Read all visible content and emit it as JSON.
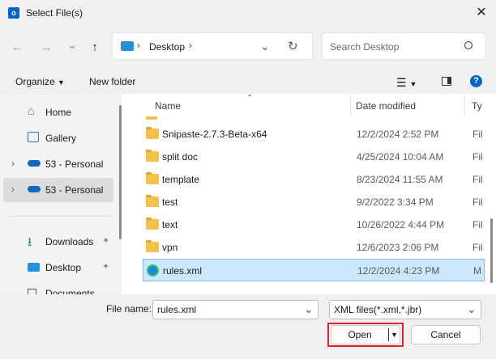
{
  "window": {
    "title": "Select File(s)",
    "app_icon": "outlook-icon",
    "close_icon": "close-icon"
  },
  "nav": {
    "back": "←",
    "forward": "→",
    "recent": "⌄",
    "up": "↑"
  },
  "address": {
    "segments": [
      "Desktop"
    ],
    "separator": "›"
  },
  "search": {
    "placeholder": "Search Desktop"
  },
  "commands": {
    "organize": "Organize",
    "new_folder": "New folder"
  },
  "sidebar": {
    "items": [
      {
        "label": "Home",
        "icon": "home-icon"
      },
      {
        "label": "Gallery",
        "icon": "gallery-icon"
      },
      {
        "label": "53 - Personal",
        "icon": "onedrive-icon"
      },
      {
        "label": "53 - Personal",
        "icon": "onedrive-icon",
        "selected": true
      },
      {
        "label": "Downloads",
        "icon": "download-icon"
      },
      {
        "label": "Desktop",
        "icon": "desktop-icon"
      },
      {
        "label": "Documents",
        "icon": "documents-icon"
      }
    ]
  },
  "columns": {
    "name": "Name",
    "date": "Date modified",
    "type": "Ty"
  },
  "files": [
    {
      "name": "Snipaste-2.7.3-Beta-x64",
      "date": "12/2/2024 2:52 PM",
      "type": "Fil"
    },
    {
      "name": "split doc",
      "date": "4/25/2024 10:04 AM",
      "type": "Fil"
    },
    {
      "name": "template",
      "date": "8/23/2024 11:55 AM",
      "type": "Fil"
    },
    {
      "name": "test",
      "date": "9/2/2022 3:34 PM",
      "type": "Fil"
    },
    {
      "name": "text",
      "date": "10/26/2022 4:44 PM",
      "type": "Fil"
    },
    {
      "name": "vpn",
      "date": "12/6/2023 2:06 PM",
      "type": "Fil"
    },
    {
      "name": "rules.xml",
      "date": "12/2/2024 4:23 PM",
      "type": "M",
      "selected": true
    }
  ],
  "footer": {
    "file_name_label": "File name:",
    "file_name_value": "rules.xml",
    "filter_value": "XML files(*.xml,*.jbr)",
    "open_label": "Open",
    "cancel_label": "Cancel"
  },
  "colors": {
    "accent": "#0067c0",
    "selection": "#cce8ff",
    "folder": "#f2c14e",
    "highlight_border": "#e0202a"
  }
}
